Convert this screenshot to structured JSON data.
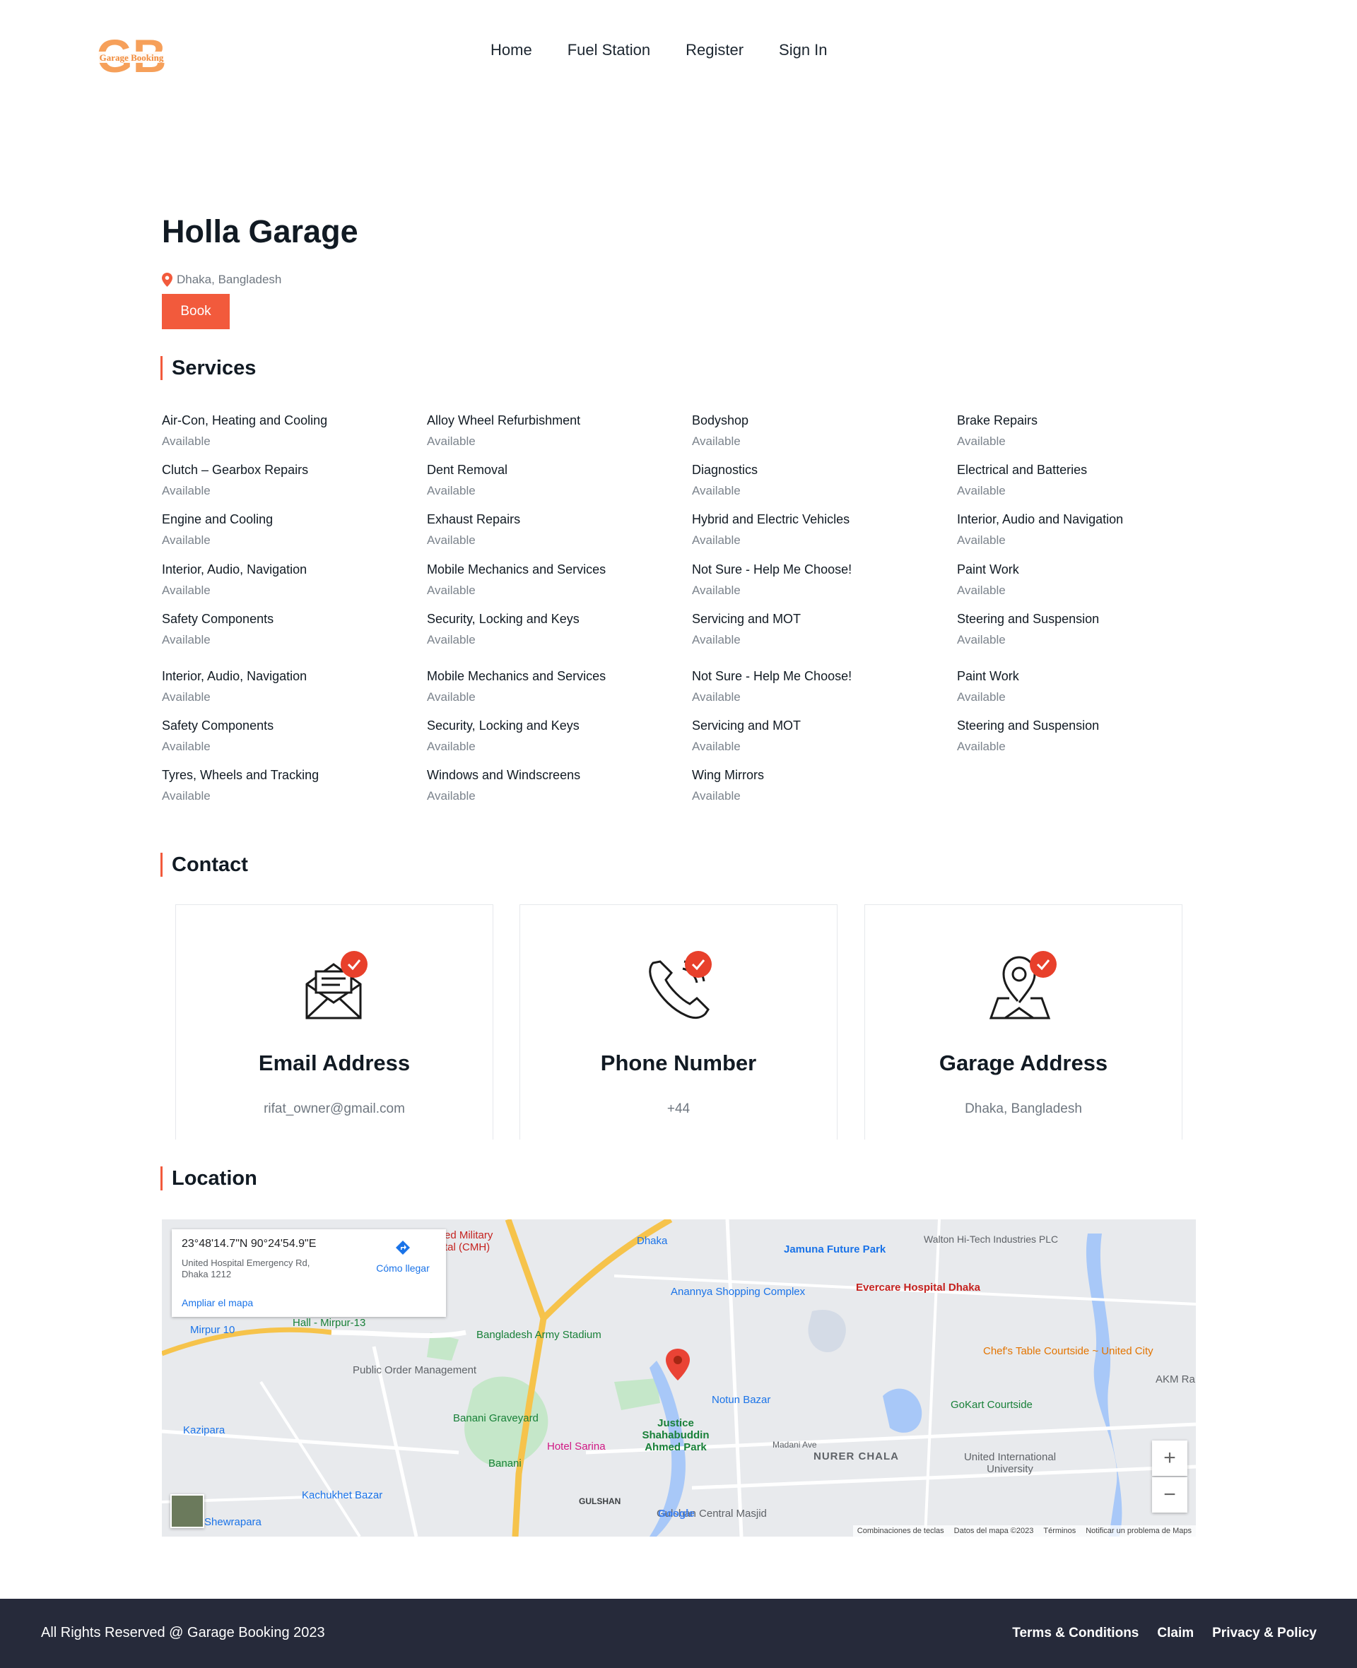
{
  "header": {
    "logo_text": "Garage Booking",
    "logo_letters": "GB",
    "nav": [
      "Home",
      "Fuel Station",
      "Register",
      "Sign In"
    ]
  },
  "garage": {
    "name": "Holla Garage",
    "location": "Dhaka, Bangladesh",
    "book_label": "Book"
  },
  "services": {
    "heading": "Services",
    "items": [
      {
        "name": "Air-Con, Heating and Cooling",
        "status": "Available"
      },
      {
        "name": "Alloy Wheel Refurbishment",
        "status": "Available"
      },
      {
        "name": "Bodyshop",
        "status": "Available"
      },
      {
        "name": "Brake Repairs",
        "status": "Available"
      },
      {
        "name": "Clutch – Gearbox Repairs",
        "status": "Available"
      },
      {
        "name": "Dent Removal",
        "status": "Available"
      },
      {
        "name": "Diagnostics",
        "status": "Available"
      },
      {
        "name": "Electrical and Batteries",
        "status": "Available"
      },
      {
        "name": "Engine and Cooling",
        "status": "Available"
      },
      {
        "name": "Exhaust Repairs",
        "status": "Available"
      },
      {
        "name": "Hybrid and Electric Vehicles",
        "status": "Available"
      },
      {
        "name": "Interior, Audio and Navigation",
        "status": "Available"
      },
      {
        "name": "Interior, Audio, Navigation",
        "status": "Available"
      },
      {
        "name": "Mobile Mechanics and Services",
        "status": "Available"
      },
      {
        "name": "Not Sure - Help Me Choose!",
        "status": "Available"
      },
      {
        "name": "Paint Work",
        "status": "Available"
      },
      {
        "name": "Safety Components",
        "status": "Available"
      },
      {
        "name": "Security, Locking and Keys",
        "status": "Available"
      },
      {
        "name": "Servicing and MOT",
        "status": "Available"
      },
      {
        "name": "Steering and Suspension",
        "status": "Available"
      },
      {
        "name": "Interior, Audio, Navigation",
        "status": "Available"
      },
      {
        "name": "Mobile Mechanics and Services",
        "status": "Available"
      },
      {
        "name": "Not Sure - Help Me Choose!",
        "status": "Available"
      },
      {
        "name": "Paint Work",
        "status": "Available"
      },
      {
        "name": "Safety Components",
        "status": "Available"
      },
      {
        "name": "Security, Locking and Keys",
        "status": "Available"
      },
      {
        "name": "Servicing and MOT",
        "status": "Available"
      },
      {
        "name": "Steering and Suspension",
        "status": "Available"
      },
      {
        "name": "Tyres, Wheels and Tracking",
        "status": "Available"
      },
      {
        "name": "Windows and Windscreens",
        "status": "Available"
      },
      {
        "name": "Wing Mirrors",
        "status": "Available"
      }
    ]
  },
  "contact": {
    "heading": "Contact",
    "cards": [
      {
        "title": "Email Address",
        "value": "rifat_owner@gmail.com",
        "icon": "email-icon"
      },
      {
        "title": "Phone Number",
        "value": "+44",
        "icon": "phone-icon"
      },
      {
        "title": "Garage Address",
        "value": "Dhaka, Bangladesh",
        "icon": "map-pin-icon"
      }
    ]
  },
  "location": {
    "heading": "Location",
    "map": {
      "coords": "23°48'14.7\"N 90°24'54.9\"E",
      "address_line1": "United Hospital Emergency Rd,",
      "address_line2": "Dhaka 1212",
      "directions_label": "Cómo llegar",
      "enlarge_label": "Ampliar el mapa",
      "zoom_in": "+",
      "zoom_out": "−",
      "footer": [
        "Combinaciones de teclas",
        "Datos del mapa ©2023",
        "Términos",
        "Notificar un problema de Maps"
      ],
      "places": [
        "Jamuna Future Park",
        "Walton Hi-Tech Industries PLC",
        "Anannya Shopping Complex",
        "Evercare Hospital Dhaka",
        "Bangladesh Army Stadium",
        "Chef's Table Courtside ~ United City",
        "Public Order Management",
        "Notun Bazar",
        "GoKart Courtside",
        "Banani Graveyard",
        "Justice Shahabuddin Ahmed Park",
        "Hotel Sarina",
        "NURER CHALA",
        "United International University",
        "Kachukhet Bazar",
        "Mirpur 10",
        "Kazipara",
        "Shewrapara",
        "GULSHAN",
        "Gulshan Central Masjid",
        "Dhaka",
        "Banani",
        "Madani Ave",
        "AKM Ra",
        "Hall - Mirpur-13",
        "ed Military tal (CMH)",
        "Google"
      ]
    }
  },
  "footer": {
    "copyright": "All Rights Reserved @ Garage Booking 2023",
    "links": [
      "Terms & Conditions",
      "Claim",
      "Privacy & Policy"
    ]
  },
  "colors": {
    "accent": "#f25a3c",
    "logo": "#f6a05a",
    "footer_bg": "#262a3a",
    "map_blue": "#1a73e8"
  }
}
